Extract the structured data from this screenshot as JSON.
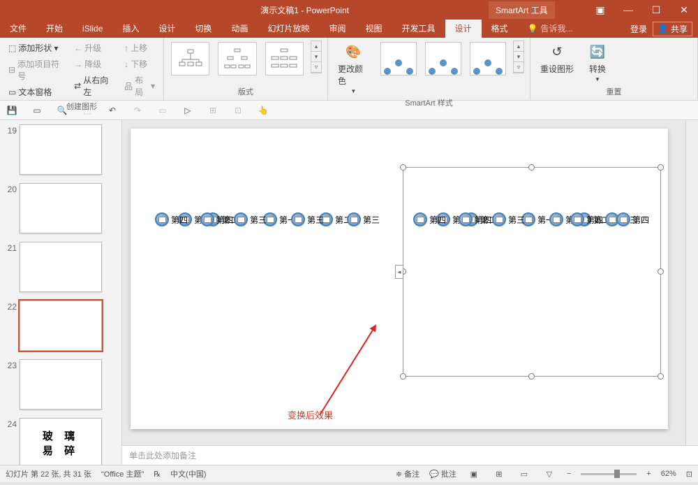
{
  "title": "演示文稿1 - PowerPoint",
  "context_tool": "SmartArt 工具",
  "menus": {
    "file": "文件",
    "home": "开始",
    "islide": "iSlide",
    "insert": "插入",
    "design": "设计",
    "transitions": "切换",
    "animations": "动画",
    "slideshow": "幻灯片放映",
    "review": "审阅",
    "view": "视图",
    "devtools": "开发工具",
    "sa_design": "设计",
    "sa_format": "格式"
  },
  "tellme_placeholder": "告诉我...",
  "login": "登录",
  "share": "共享",
  "ribbon": {
    "create_graphic": {
      "add_shape": "添加形状",
      "add_bullet": "添加项目符号",
      "text_pane": "文本窗格",
      "promote": "升级",
      "demote": "降级",
      "move_up": "上移",
      "move_down": "下移",
      "rtl": "从右向左",
      "layout": "布局",
      "label": "创建图形"
    },
    "layouts_label": "版式",
    "change_colors": "更改颜色",
    "styles_label": "SmartArt 样式",
    "reset_graphic": "重设图形",
    "convert": "转换",
    "reset_label": "重置"
  },
  "slide_numbers": [
    "19",
    "20",
    "21",
    "22",
    "23",
    "24"
  ],
  "thumb24": {
    "l1": "玻 璃",
    "l2": "易 碎"
  },
  "tree_nodes": {
    "l1": "第一",
    "l2": "第二",
    "l3": "第三",
    "l4": "第四"
  },
  "annotation": "变换后效果",
  "notes_placeholder": "单击此处添加备注",
  "status": {
    "slide_info": "幻灯片 第 22 张, 共 31 张",
    "theme": "\"Office 主题\"",
    "lang": "中文(中国)",
    "notes": "备注",
    "comments": "批注",
    "zoom": "62%"
  }
}
